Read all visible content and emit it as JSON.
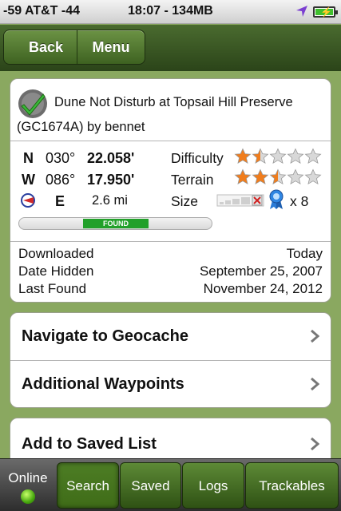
{
  "status_bar": {
    "carrier": "-59 AT&T  -44",
    "time": "18:07 - 134MB"
  },
  "nav": {
    "back_label": "Back",
    "menu_label": "Menu"
  },
  "cache": {
    "title_line1": "Dune Not Disturb at Topsail Hill Preserve",
    "title_line2": "(GC1674A) by bennet",
    "lat_hemisphere": "N",
    "lat_deg": "030°",
    "lat_min": "22.058'",
    "lon_hemisphere": "W",
    "lon_deg": "086°",
    "lon_min": "17.950'",
    "direction": "E",
    "distance": "2.6 mi",
    "difficulty_label": "Difficulty",
    "difficulty_rating": 1.5,
    "terrain_label": "Terrain",
    "terrain_rating": 2.5,
    "size_label": "Size",
    "favorites": "x 8",
    "found_label": "FOUND",
    "downloaded_label": "Downloaded",
    "downloaded_value": "Today",
    "hidden_label": "Date Hidden",
    "hidden_value": "September 25, 2007",
    "last_found_label": "Last Found",
    "last_found_value": "November 24, 2012"
  },
  "actions": [
    {
      "label": "Navigate to Geocache"
    },
    {
      "label": "Additional Waypoints"
    },
    {
      "label": "Add to Saved List"
    }
  ],
  "tabbar": {
    "online_label": "Online",
    "tabs": [
      {
        "label": "Search",
        "active": true
      },
      {
        "label": "Saved"
      },
      {
        "label": "Logs"
      },
      {
        "label": "Trackables"
      }
    ]
  },
  "colors": {
    "star_fill": "#f07d1d",
    "star_empty": "#d8d8d8",
    "found_green": "#22a02a",
    "nav_green": "#3e6221"
  }
}
